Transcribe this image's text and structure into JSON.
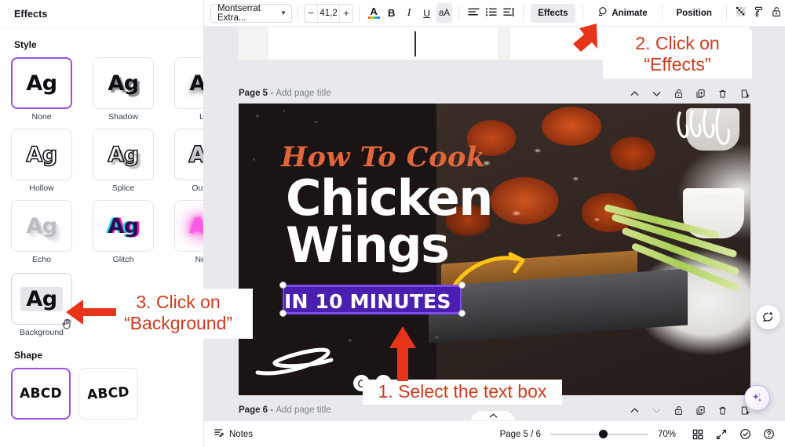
{
  "app": {
    "name": "Canva Editor"
  },
  "left_panel": {
    "title": "Effects",
    "style_label": "Style",
    "shape_label": "Shape",
    "styles": [
      {
        "label": "None",
        "selected": true
      },
      {
        "label": "Shadow",
        "selected": false
      },
      {
        "label": "Lift",
        "selected": false
      },
      {
        "label": "Hollow",
        "selected": false
      },
      {
        "label": "Splice",
        "selected": false
      },
      {
        "label": "Outline",
        "selected": false
      },
      {
        "label": "Echo",
        "selected": false
      },
      {
        "label": "Glitch",
        "selected": false
      },
      {
        "label": "Neon",
        "selected": false
      }
    ],
    "swatch_sample": "Ag",
    "background_style": {
      "label": "Background",
      "sample": "Ag"
    },
    "shapes": [
      {
        "label": "ABCD",
        "sample": "ABCD",
        "selected": true
      },
      {
        "label": "ABCD",
        "sample": "ABCD",
        "selected": false
      }
    ],
    "selection_accent": "#9b51e0"
  },
  "toolbar": {
    "font_name": "Montserrat Extra...",
    "font_size": "41,2",
    "decrease_label": "−",
    "increase_label": "+",
    "text_color_label": "A",
    "bold_label": "B",
    "italic_label": "I",
    "underline_label": "U",
    "case_label": "aA",
    "effects_label": "Effects",
    "animate_label": "Animate",
    "position_label": "Position"
  },
  "canvas": {
    "pages": [
      {
        "number_label": "Page 5",
        "separator": "-",
        "title_placeholder": "Add page title"
      },
      {
        "number_label": "Page 6",
        "separator": "-",
        "title_placeholder": "Add page title"
      }
    ],
    "design": {
      "script_title": "How To Cook",
      "heading_line1": "Chicken",
      "heading_line2": "Wings",
      "subtitle": "IN 10 MINUTES",
      "subtitle_bg_color": "#4a1fb0",
      "accent_script_color": "#e2663a",
      "background_color": "#1a1415"
    }
  },
  "annotations": [
    {
      "id": "step2",
      "line1": "2. Click on",
      "line2": "“Effects”"
    },
    {
      "id": "step3",
      "line1": "3. Click on",
      "line2": "“Background”"
    },
    {
      "id": "step1",
      "line1": "1. Select the text box",
      "line2": ""
    }
  ],
  "annotation_color": "#cf3a1e",
  "bottom_bar": {
    "notes_label": "Notes",
    "page_indicator": "Page 5 / 6",
    "zoom_value": "70%"
  }
}
